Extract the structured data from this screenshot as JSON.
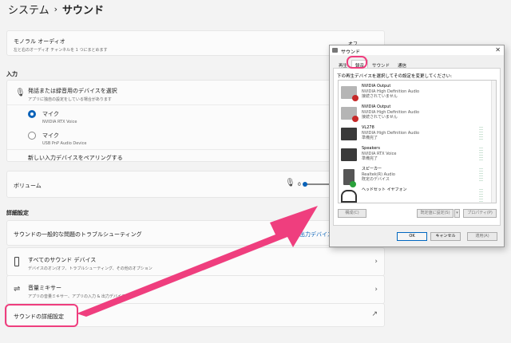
{
  "breadcrumb": {
    "parent": "システム",
    "separator": "›",
    "current": "サウンド"
  },
  "mono": {
    "title": "モノラル オーディオ",
    "subtitle": "左と右のオーディオ チャンネルを 1 つにまとめます",
    "toggle_label": "オフ"
  },
  "input": {
    "section": "入力",
    "choose_title": "発話または録音用のデバイスを選択",
    "choose_subtitle": "アプリに独自の設定をしている場合があります",
    "devices": [
      {
        "name": "マイク",
        "detail": "NVIDIA RTX Voice",
        "selected": true
      },
      {
        "name": "マイク",
        "detail": "USB PnP Audio Device",
        "selected": false
      }
    ],
    "pair_label": "新しい入力デバイスをペアリングする",
    "volume_label": "ボリューム",
    "volume_value": "0"
  },
  "advanced": {
    "section": "詳細設定",
    "troubleshoot": "サウンドの一般的な問題のトラブルシューティング",
    "troubleshoot_link": "出力デバイス",
    "all_devices_title": "すべてのサウンド デバイス",
    "all_devices_subtitle": "デバイスのオン/オフ、トラブルシューティング、その他のオプション",
    "mixer_title": "音量ミキサー",
    "mixer_subtitle": "アプリの音量ミキサー、アプリの入力 & 出力デバイス",
    "more_settings": "サウンドの詳細設定"
  },
  "dialog": {
    "title": "サウンド",
    "close": "✕",
    "tabs": [
      "再生",
      "録音",
      "サウンド",
      "通信"
    ],
    "active_tab": 1,
    "instruction": "下の再生デバイスを選択してその設定を変更してください:",
    "devices": [
      {
        "name": "NVIDIA Output",
        "driver": "NVIDIA High Definition Audio",
        "status": "接続されていません",
        "icon": "monitor-disconnected-icon"
      },
      {
        "name": "NVIDIA Output",
        "driver": "NVIDIA High Definition Audio",
        "status": "接続されていません",
        "icon": "monitor-disconnected-icon"
      },
      {
        "name": "VL278",
        "driver": "NVIDIA High Definition Audio",
        "status": "準備完了",
        "icon": "monitor-icon"
      },
      {
        "name": "Speakers",
        "driver": "NVIDIA RTX Voice",
        "status": "準備完了",
        "icon": "monitor-icon"
      },
      {
        "name": "スピーカー",
        "driver": "Realtek(R) Audio",
        "status": "既定のデバイス",
        "icon": "speaker-default-icon"
      },
      {
        "name": "ヘッドセット イヤフォン",
        "driver": "",
        "status": "",
        "icon": "headset-icon"
      }
    ],
    "configure": "構成(C)",
    "set_default": "既定値に設定(S)",
    "properties": "プロパティ(P)",
    "ok": "OK",
    "cancel": "キャンセル",
    "apply": "適用(A)"
  },
  "colors": {
    "highlight": "#ef3e7e",
    "accent": "#0a62b8",
    "default_check": "#2aa13b",
    "disconnected": "#c62828"
  }
}
